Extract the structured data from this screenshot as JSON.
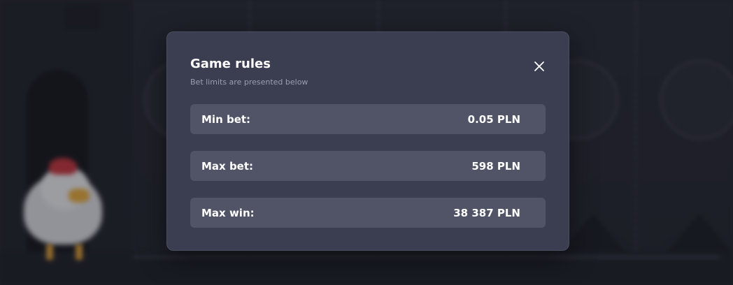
{
  "modal": {
    "title": "Game rules",
    "subtitle": "Bet limits are presented below",
    "close_icon": "close-icon",
    "rows": [
      {
        "label": "Min bet:",
        "value": "0.05 PLN"
      },
      {
        "label": "Max bet:",
        "value": "598 PLN"
      },
      {
        "label": "Max win:",
        "value": "38 387 PLN"
      }
    ]
  },
  "colors": {
    "overlay_background": "#24252f",
    "modal_background": "#3a3e50",
    "row_background": "#505466",
    "text_primary": "#ffffff",
    "text_secondary": "#9a9eaf"
  }
}
